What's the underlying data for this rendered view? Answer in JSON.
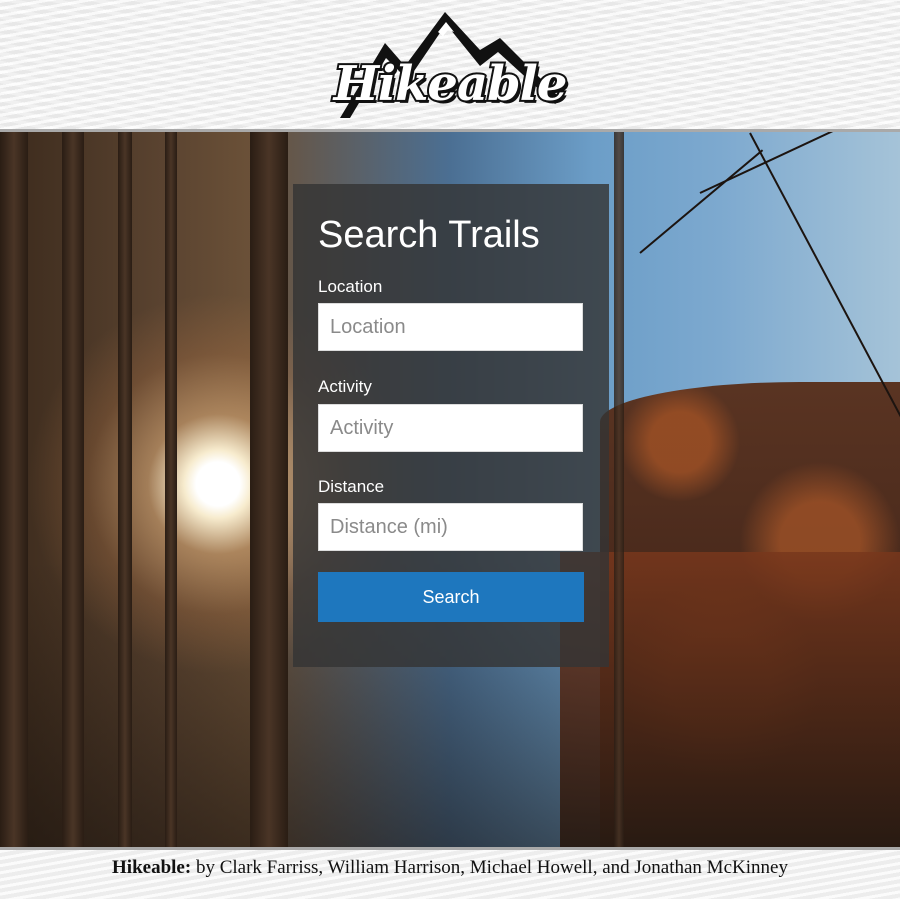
{
  "brand": {
    "logo_text": "Hikeable",
    "logo_icon": "mountain-icon"
  },
  "search_panel": {
    "title": "Search Trails",
    "fields": [
      {
        "label": "Location",
        "placeholder": "Location",
        "value": ""
      },
      {
        "label": "Activity",
        "placeholder": "Activity",
        "value": ""
      },
      {
        "label": "Distance",
        "placeholder": "Distance (mi)",
        "value": ""
      }
    ],
    "button_label": "Search",
    "button_color": "#1e77be"
  },
  "footer": {
    "brand": "Hikeable:",
    "credits": " by Clark Farriss, William Harrison, Michael Howell, and Jonathan McKinney"
  }
}
